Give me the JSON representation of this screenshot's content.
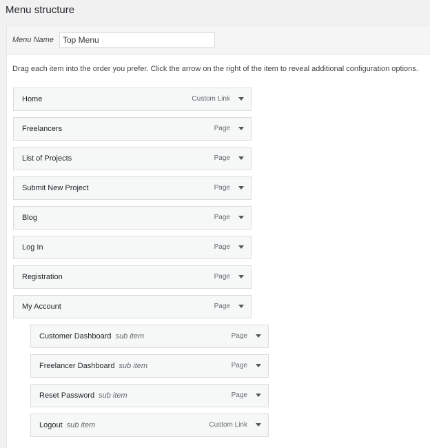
{
  "page": {
    "title": "Menu structure"
  },
  "menu": {
    "name_label": "Menu Name",
    "name_value": "Top Menu",
    "instructions": "Drag each item into the order you prefer. Click the arrow on the right of the item to reveal additional configuration options."
  },
  "items": [
    {
      "title": "Home",
      "sub": "",
      "type": "Custom Link",
      "depth": 0
    },
    {
      "title": "Freelancers",
      "sub": "",
      "type": "Page",
      "depth": 0
    },
    {
      "title": "List of Projects",
      "sub": "",
      "type": "Page",
      "depth": 0
    },
    {
      "title": "Submit New Project",
      "sub": "",
      "type": "Page",
      "depth": 0
    },
    {
      "title": "Blog",
      "sub": "",
      "type": "Page",
      "depth": 0
    },
    {
      "title": "Log In",
      "sub": "",
      "type": "Page",
      "depth": 0
    },
    {
      "title": "Registration",
      "sub": "",
      "type": "Page",
      "depth": 0
    },
    {
      "title": "My Account",
      "sub": "",
      "type": "Page",
      "depth": 0
    },
    {
      "title": "Customer Dashboard",
      "sub": "sub item",
      "type": "Page",
      "depth": 1
    },
    {
      "title": "Freelancer Dashboard",
      "sub": "sub item",
      "type": "Page",
      "depth": 1
    },
    {
      "title": "Reset Password",
      "sub": "sub item",
      "type": "Page",
      "depth": 1
    },
    {
      "title": "Logout",
      "sub": "sub item",
      "type": "Custom Link",
      "depth": 1
    }
  ],
  "icons": {
    "item_toggle": "triangle-down-icon"
  }
}
